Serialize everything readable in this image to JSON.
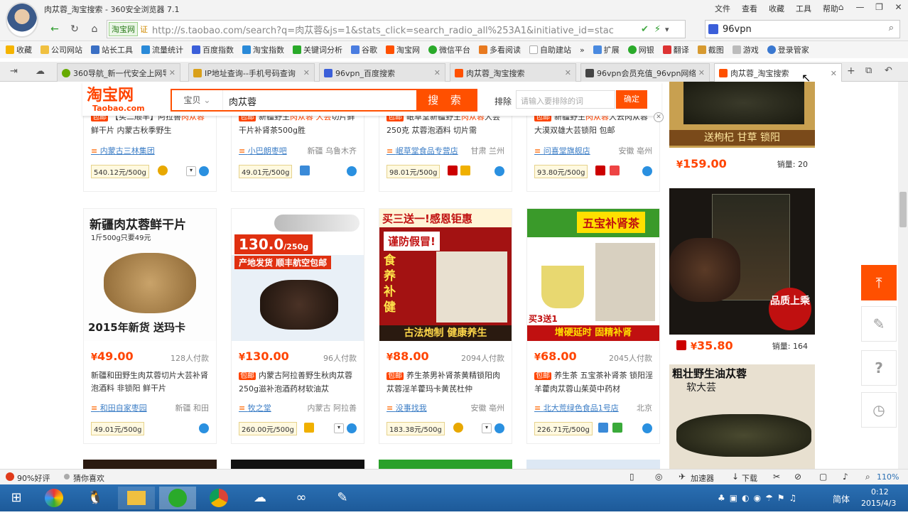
{
  "window": {
    "title": "肉苁蓉_淘宝搜索 - 360安全浏览器 7.1",
    "menu": [
      "文件",
      "查看",
      "收藏",
      "工具",
      "帮助"
    ]
  },
  "nav": {
    "site_badge": "淘宝网",
    "url": "http://s.taobao.com/search?q=肉苁蓉&js=1&stats_click=search_radio_all%253A1&initiative_id=stac",
    "search_value": "96vpn"
  },
  "bookmarks": {
    "items": [
      "收藏",
      "公司网站",
      "站长工具",
      "流量统计",
      "百度指数",
      "淘宝指数",
      "关键词分析",
      "谷歌",
      "淘宝网",
      "微信平台",
      "多看阅读",
      "自助建站"
    ],
    "right_items": [
      "扩展",
      "网银",
      "翻译",
      "截图",
      "游戏",
      "登录管家"
    ]
  },
  "tabs": [
    {
      "label": "360导航_新一代安全上网导"
    },
    {
      "label": "IP地址查询--手机号码查询"
    },
    {
      "label": "96vpn_百度搜索"
    },
    {
      "label": "肉苁蓉_淘宝搜索"
    },
    {
      "label": "96vpn会员充值_96vpn网络"
    },
    {
      "label": "肉苁蓉_淘宝搜索"
    }
  ],
  "taobao": {
    "logo": "淘宝网",
    "logo_sub": "Taobao.com",
    "search_type": "宝贝",
    "query": "肉苁蓉",
    "search_button": "搜 索",
    "exclude_label": "排除",
    "exclude_placeholder": "请输入要排除的词",
    "exclude_button": "确定"
  },
  "top_row": [
    {
      "title_a": "【买二顺丰】阿拉善",
      "kw1": "肉苁蓉",
      "title_b": "鲜干片 内蒙古秋季野生",
      "shop": "内蒙古三林集团",
      "loc": "",
      "unit": "540.12元/500g",
      "baoyou": "包邮"
    },
    {
      "title_a": "新疆野生",
      "kw1": "肉苁蓉 大芸",
      "title_b": "切片鲜干片补肾茶500g胜",
      "shop": "小巴朗枣吧",
      "loc": "新疆 乌鲁木齐",
      "unit": "49.01元/500g",
      "baoyou": "包邮"
    },
    {
      "title_a": "岷草堂新疆野生",
      "kw1": "肉苁蓉",
      "title_b": "大芸250克 苁蓉泡酒料 切片需",
      "shop": "岷草堂食品专营店",
      "loc": "甘肃 兰州",
      "unit": "98.01元/500g",
      "baoyou": "包邮"
    },
    {
      "title_a": "新疆野生",
      "kw1": "肉苁蓉",
      "title_b": "大云肉苁蓉 大漠双雄大芸锁阳 包邮",
      "shop": "问喜堂旗舰店",
      "loc": "安徽 亳州",
      "unit": "93.80元/500g",
      "baoyou": "包邮"
    }
  ],
  "products": [
    {
      "img_text": "新疆肉苁蓉鲜干片",
      "img_sub": "1斤500g只要49元",
      "img_bottom": "2015年新货 送玛卡",
      "price": "49.00",
      "sold": "128人付款",
      "baoyou": "",
      "title": "新疆和田野生肉苁蓉切片大芸补肾泡酒料 非锁阳 鲜干片",
      "shop": "和田自家枣园",
      "loc": "新疆 和田",
      "unit": "49.01元/500g"
    },
    {
      "img_text": "130.0",
      "img_sub": "/250g",
      "img_bottom": "产地发货 顺丰航空包邮",
      "price": "130.00",
      "sold": "96人付款",
      "baoyou": "包邮",
      "title": "内蒙古阿拉善野生秋肉苁蓉250g滋补泡酒药材软油苁",
      "shop": "牧之堂",
      "loc": "内蒙古 阿拉善",
      "unit": "260.00元/500g"
    },
    {
      "img_text": "买三送一!感恩钜惠",
      "img_sub": "谨防假冒!",
      "img_bottom": "古法炮制 健康养生",
      "price": "88.00",
      "sold": "2094人付款",
      "baoyou": "包邮",
      "title": "养生茶男补肾茶黄精锁阳肉苁蓉淫羊藿玛卡黄芪杜仲",
      "shop": "没事找我",
      "loc": "安徽 亳州",
      "unit": "183.38元/500g"
    },
    {
      "img_text": "五宝补肾茶",
      "img_sub": "买3送1",
      "img_bottom": "增硬延时 固精补肾",
      "price": "68.00",
      "sold": "2045人付款",
      "baoyou": "包邮",
      "title": "养生茶 五宝茶补肾茶 锁阳淫羊藿肉苁蓉山茱萸中药材",
      "shop": "北大荒绿色食品1号店",
      "loc": "北京",
      "unit": "226.71元/500g"
    }
  ],
  "right_col": [
    {
      "img_text": "送枸杞 甘草 锁阳",
      "price": "159.00",
      "sold": "销量: 20"
    },
    {
      "img_text": "品质上乘",
      "price": "35.80",
      "sold": "销量: 164"
    },
    {
      "img_text": "粗壮野生油苁蓉",
      "img_sub": "软大芸"
    }
  ],
  "statusbar": {
    "rating": "90%好评",
    "guess": "猜你喜欢",
    "accelerate": "加速器",
    "download": "下载",
    "zoom": "110%"
  },
  "taskbar": {
    "lang": "简体",
    "time": "0:12",
    "date": "2015/4/3"
  },
  "colors": {
    "accent": "#ff5000",
    "price": "#ff4400",
    "link": "#3c7ec6"
  }
}
